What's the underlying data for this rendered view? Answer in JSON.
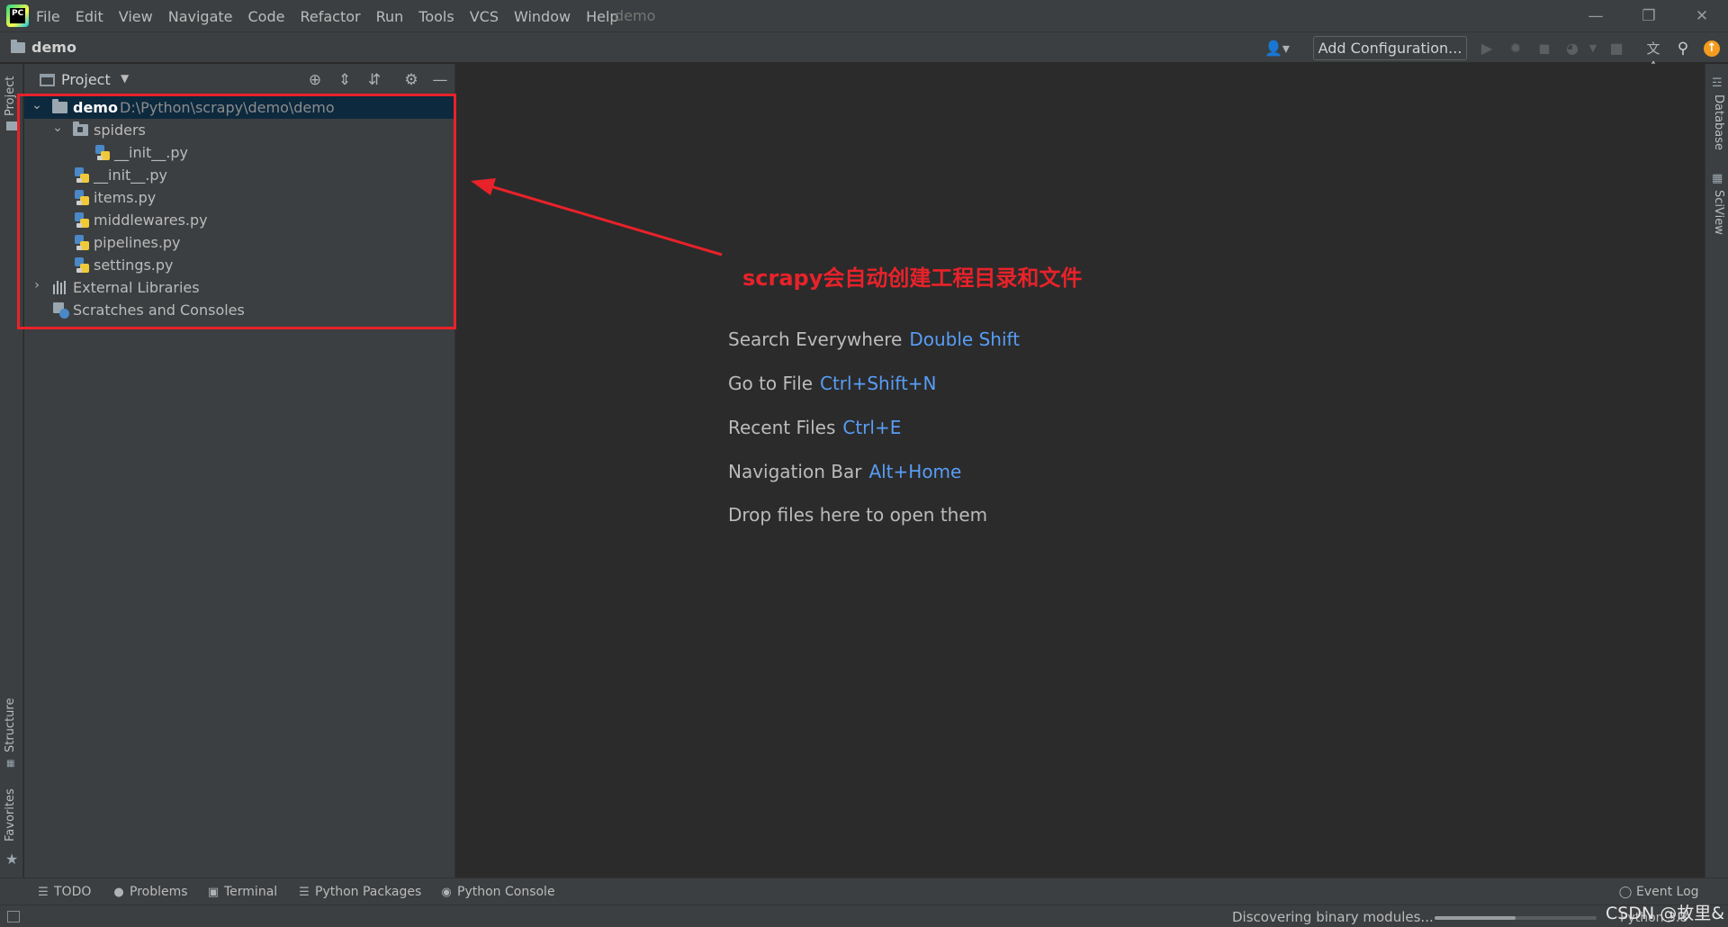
{
  "menubar": {
    "items": [
      "File",
      "Edit",
      "View",
      "Navigate",
      "Code",
      "Refactor",
      "Run",
      "Tools",
      "VCS",
      "Window",
      "Help"
    ],
    "window_title": "demo"
  },
  "navbar": {
    "breadcrumb": "demo",
    "add_configuration": "Add Configuration..."
  },
  "project_panel": {
    "title": "Project",
    "tree": [
      {
        "label": "demo",
        "path": "D:\\Python\\scrapy\\demo\\demo"
      },
      {
        "label": "spiders"
      },
      {
        "label": "__init__.py"
      },
      {
        "label": "__init__.py"
      },
      {
        "label": "items.py"
      },
      {
        "label": "middlewares.py"
      },
      {
        "label": "pipelines.py"
      },
      {
        "label": "settings.py"
      },
      {
        "label": "External Libraries"
      },
      {
        "label": "Scratches and Consoles"
      }
    ]
  },
  "left_stripe": {
    "project": "Project",
    "structure": "Structure",
    "favorites": "Favorites"
  },
  "right_stripe": {
    "database": "Database",
    "sciview": "SciView"
  },
  "annotation": {
    "text": "scrapy会自动创建工程目录和文件",
    "color": "#e8222a"
  },
  "editor_hints": [
    {
      "text": "Search Everywhere",
      "shortcut": "Double Shift"
    },
    {
      "text": "Go to File",
      "shortcut": "Ctrl+Shift+N"
    },
    {
      "text": "Recent Files",
      "shortcut": "Ctrl+E"
    },
    {
      "text": "Navigation Bar",
      "shortcut": "Alt+Home"
    },
    {
      "text": "Drop files here to open them",
      "shortcut": ""
    }
  ],
  "bottom_tabs": [
    {
      "label": "TODO",
      "icon": "list-icon"
    },
    {
      "label": "Problems",
      "icon": "info-icon"
    },
    {
      "label": "Terminal",
      "icon": "terminal-icon"
    },
    {
      "label": "Python Packages",
      "icon": "layers-icon"
    },
    {
      "label": "Python Console",
      "icon": "python-icon"
    }
  ],
  "event_log": "Event Log",
  "status": {
    "message": "Discovering binary modules...",
    "progress": 0.5,
    "interpreter": "Python 3.8"
  },
  "watermark": "CSDN @故里&",
  "colors": {
    "accent_link": "#589df6",
    "selection": "#0d293e",
    "background": "#2b2b2b",
    "panel": "#3c3f41"
  }
}
